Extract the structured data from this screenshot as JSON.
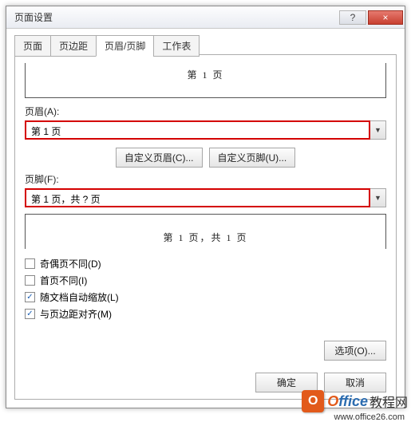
{
  "dialog": {
    "title": "页面设置",
    "help_glyph": "?",
    "close_glyph": "×"
  },
  "tabs": {
    "page": "页面",
    "margins": "页边距",
    "header_footer": "页眉/页脚",
    "sheet": "工作表"
  },
  "preview": {
    "header_text": "第 1 页",
    "footer_text": "第 1 页，共 1 页"
  },
  "header": {
    "label": "页眉(A):",
    "value": "第 1 页"
  },
  "footer": {
    "label": "页脚(F):",
    "value": "第 1 页，共 ? 页"
  },
  "buttons": {
    "custom_header": "自定义页眉(C)...",
    "custom_footer": "自定义页脚(U)...",
    "options": "选项(O)...",
    "ok": "确定",
    "cancel": "取消"
  },
  "checks": {
    "odd_even": {
      "label": "奇偶页不同(D)",
      "checked": false
    },
    "first_page": {
      "label": "首页不同(I)",
      "checked": false
    },
    "scale": {
      "label": "随文档自动缩放(L)",
      "checked": true
    },
    "align": {
      "label": "与页边距对齐(M)",
      "checked": true
    }
  },
  "watermark": {
    "logo_letter": "O",
    "text_orange": "O",
    "text_blue": "ffice",
    "text_suffix": "教程网",
    "url": "www.office26.com"
  }
}
